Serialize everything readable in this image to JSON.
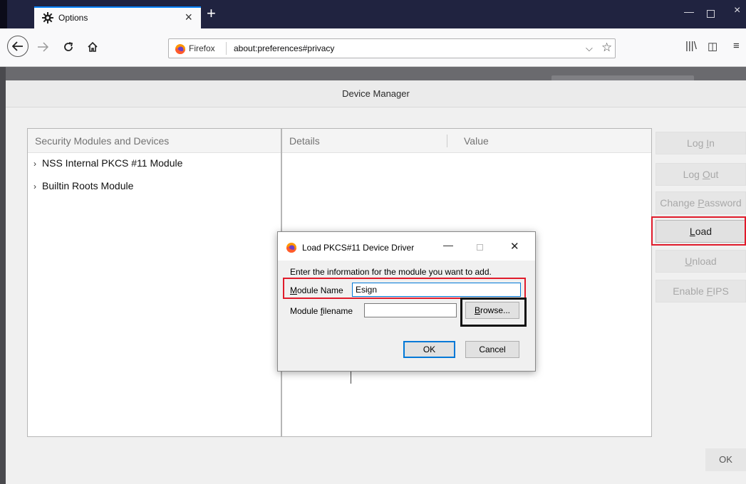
{
  "browser": {
    "tab_title": "Options",
    "url_identity": "Firefox",
    "url": "about:preferences#privacy"
  },
  "device_manager": {
    "title": "Device Manager",
    "columns": {
      "modules": "Security Modules and Devices",
      "details": "Details",
      "value": "Value"
    },
    "modules": [
      {
        "label": "NSS Internal PKCS #11 Module"
      },
      {
        "label": "Builtin Roots Module"
      }
    ],
    "buttons": {
      "login": "Log In",
      "logout": "Log Out",
      "change_password": "Change Password",
      "load": "Load",
      "unload": "Unload",
      "enable_fips": "Enable FIPS",
      "ok": "OK"
    }
  },
  "load_dialog": {
    "title": "Load PKCS#11 Device Driver",
    "message": "Enter the information for the module you want to add.",
    "module_name_label": "Module Name",
    "module_name_value": "Esign",
    "module_filename_label": "Module filename",
    "module_filename_value": "",
    "browse": "Browse...",
    "ok": "OK",
    "cancel": "Cancel"
  },
  "colors": {
    "highlight_red": "#e01b2b",
    "highlight_black": "#111111",
    "accent_blue": "#0078d7"
  }
}
